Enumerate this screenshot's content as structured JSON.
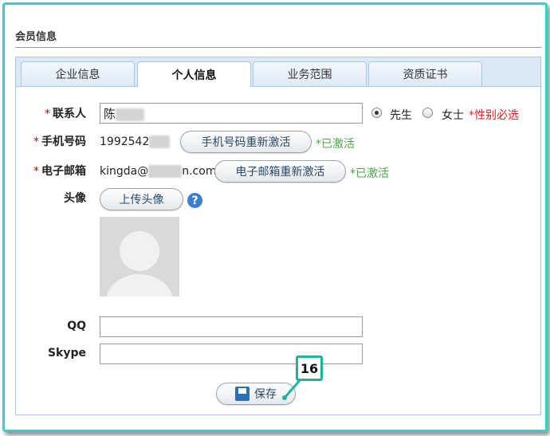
{
  "section_title": "会员信息",
  "tabs": [
    {
      "label": "企业信息",
      "active": false
    },
    {
      "label": "个人信息",
      "active": true
    },
    {
      "label": "业务范围",
      "active": false
    },
    {
      "label": "资质证书",
      "active": false
    }
  ],
  "form": {
    "contact": {
      "required_mark": "*",
      "label": "联系人",
      "value": "陈",
      "gender_options": [
        {
          "label": "先生",
          "selected": true
        },
        {
          "label": "女士",
          "selected": false
        }
      ],
      "gender_hint": "*性别必选"
    },
    "phone": {
      "required_mark": "*",
      "label": "手机号码",
      "value": "1992542",
      "reactivate_button": "手机号码重新激活",
      "status": "*已激活"
    },
    "email": {
      "required_mark": "*",
      "label": "电子邮箱",
      "value_prefix": "kingda@",
      "value_suffix": "n.com",
      "reactivate_button": "电子邮箱重新激活",
      "status": "*已激活"
    },
    "avatar": {
      "label": "头像",
      "upload_button": "上传头像",
      "help_icon": "question-mark-icon"
    },
    "qq": {
      "label": "QQ",
      "value": ""
    },
    "skype": {
      "label": "Skype",
      "value": ""
    },
    "save_button": "保存"
  },
  "callout": {
    "number": "16"
  },
  "colors": {
    "frame_border": "#33d1c8",
    "tab_bar": "#dbe9f7",
    "required": "#dd0000",
    "activated": "#4aa84a",
    "callout_border": "#1fb39a"
  }
}
